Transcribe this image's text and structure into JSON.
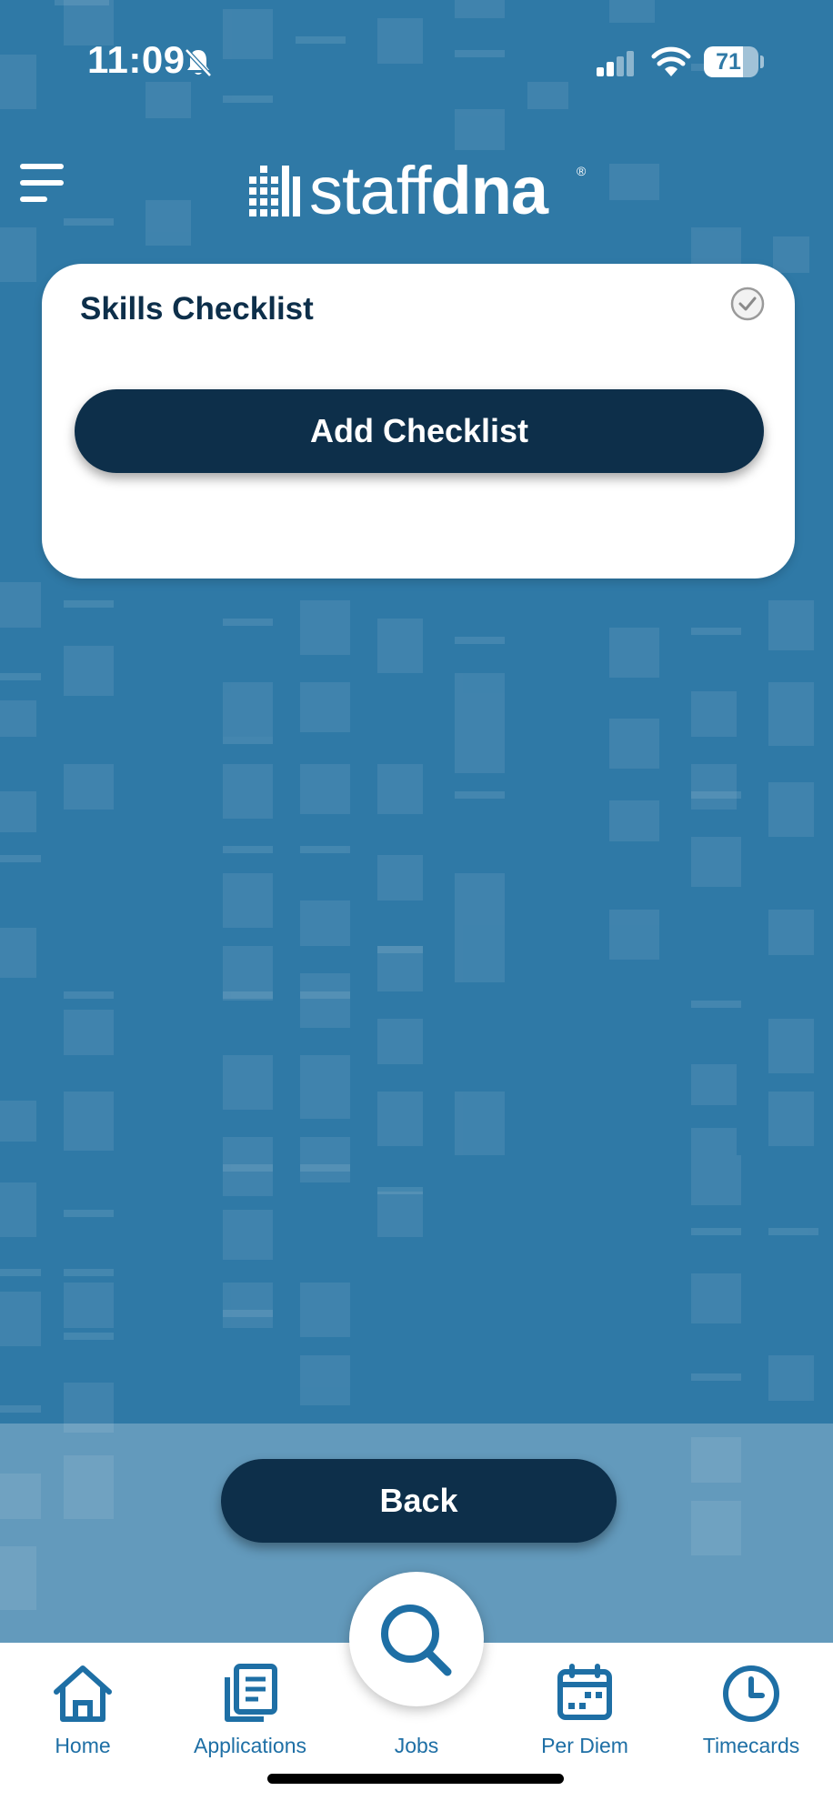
{
  "status_bar": {
    "time": "11:09",
    "battery_level": "71",
    "battery_fraction": 0.71,
    "icons": [
      "bell-slash-icon",
      "cellular-signal-icon",
      "wifi-icon",
      "battery-icon"
    ]
  },
  "header": {
    "menu_icon": "hamburger-menu-icon",
    "logo_light": "staff",
    "logo_bold": "dna",
    "logo_registered": "®"
  },
  "card": {
    "title": "Skills Checklist",
    "status_icon": "checkmark-circle-icon",
    "add_button_label": "Add Checklist"
  },
  "back_button_label": "Back",
  "tab_bar": {
    "items": [
      {
        "label": "Home",
        "icon": "home-icon"
      },
      {
        "label": "Applications",
        "icon": "documents-icon"
      },
      {
        "label": "Jobs",
        "icon": "search-icon"
      },
      {
        "label": "Per Diem",
        "icon": "calendar-icon"
      },
      {
        "label": "Timecards",
        "icon": "clock-icon"
      }
    ]
  },
  "colors": {
    "background": "#2f79a6",
    "primary_dark": "#0d2f4a",
    "tab_accent": "#1e6fa5",
    "card": "#ffffff"
  }
}
